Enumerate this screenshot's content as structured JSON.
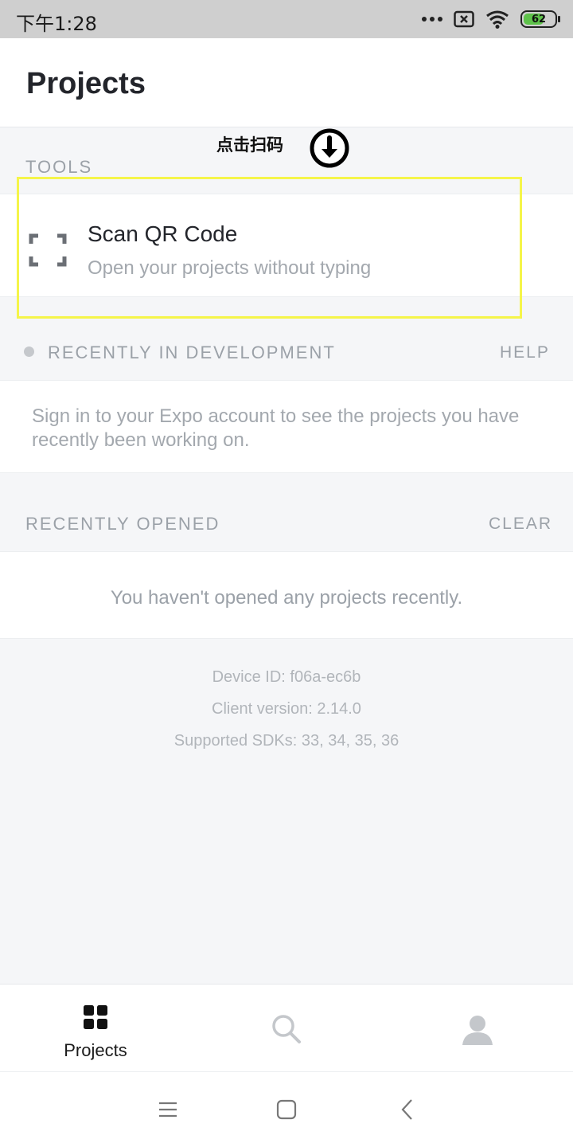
{
  "status_bar": {
    "time": "下午1:28",
    "battery_level": "62",
    "icons": [
      "more-dots-icon",
      "sim-x-icon",
      "wifi-icon",
      "battery-icon"
    ]
  },
  "header": {
    "title": "Projects"
  },
  "annotation": {
    "text": "点击扫码",
    "icon": "arrow-down-circle-icon"
  },
  "tools": {
    "label": "TOOLS",
    "scan_title": "Scan QR Code",
    "scan_subtitle": "Open your projects without typing",
    "scan_icon": "qr-scan-frame-icon"
  },
  "recent_dev": {
    "label": "RECENTLY IN DEVELOPMENT",
    "action": "HELP",
    "message": "Sign in to your Expo account to see the projects you have recently been working on."
  },
  "recent_opened": {
    "label": "RECENTLY OPENED",
    "action": "CLEAR",
    "message": "You haven't opened any projects recently."
  },
  "info": {
    "device_id": "Device ID: f06a-ec6b",
    "client_version": "Client version: 2.14.0",
    "sdks": "Supported SDKs: 33, 34, 35, 36"
  },
  "tabs": [
    {
      "label": "Projects",
      "icon": "grid-icon",
      "active": true
    },
    {
      "label": "",
      "icon": "search-icon",
      "active": false
    },
    {
      "label": "",
      "icon": "profile-icon",
      "active": false
    }
  ],
  "nav": [
    "menu-icon",
    "home-square-icon",
    "back-chevron-icon"
  ],
  "colors": {
    "highlight": "#f5f54a",
    "battery": "#5ec24a",
    "muted_text": "#9ba1a8",
    "background": "#f5f6f8"
  }
}
